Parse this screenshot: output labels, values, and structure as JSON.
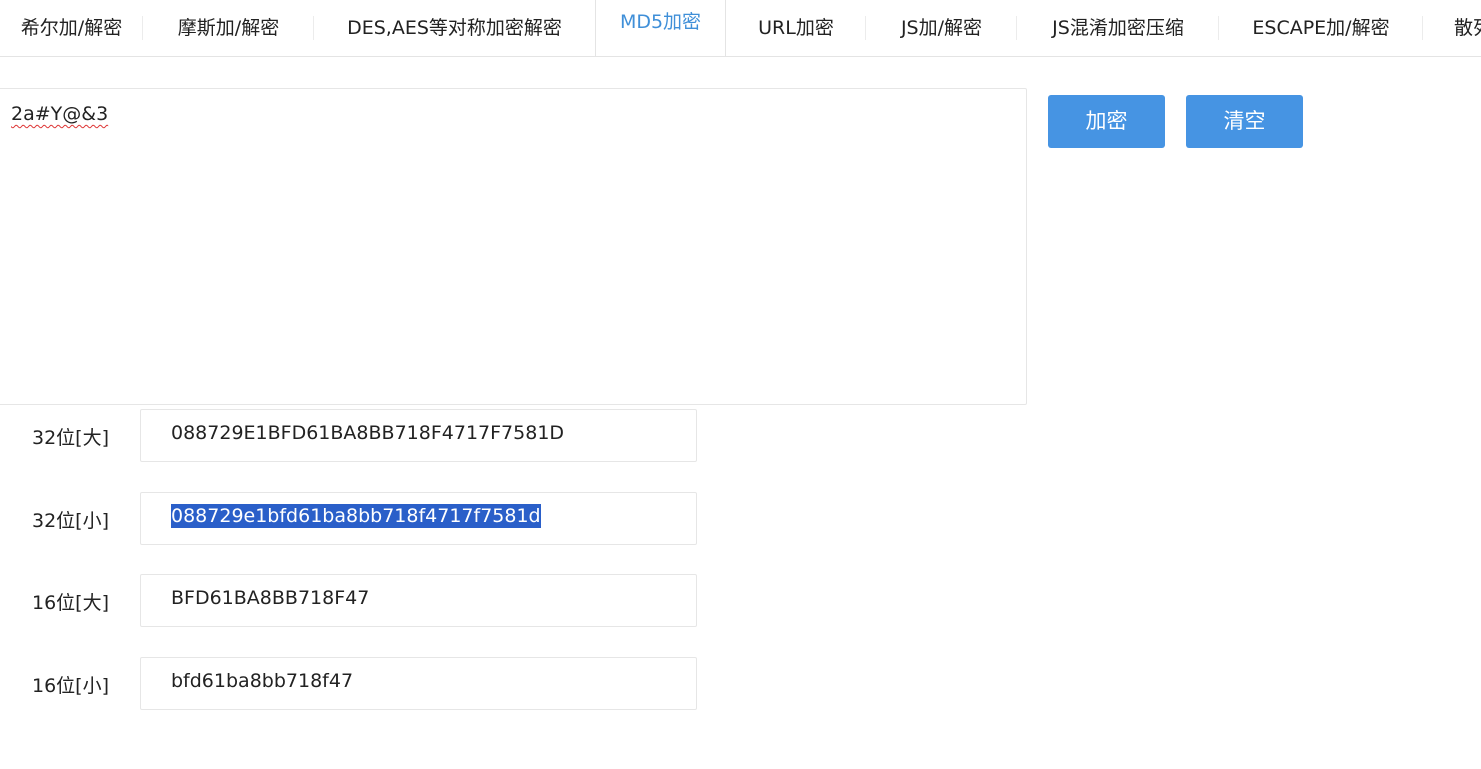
{
  "tabs": [
    {
      "label": "希尔加/解密"
    },
    {
      "label": "摩斯加/解密"
    },
    {
      "label": "DES,AES等对称加密解密"
    },
    {
      "label": "MD5加密"
    },
    {
      "label": "URL加密"
    },
    {
      "label": "JS加/解密"
    },
    {
      "label": "JS混淆加密压缩"
    },
    {
      "label": "ESCAPE加/解密"
    },
    {
      "label": "散列"
    }
  ],
  "active_tab": "MD5加密",
  "input": {
    "value": "2a#Y@&3"
  },
  "buttons": {
    "encrypt_label": "加密",
    "clear_label": "清空",
    "color": "#4694e3"
  },
  "results": [
    {
      "label": "32位[大]",
      "value": "088729E1BFD61BA8BB718F4717F7581D"
    },
    {
      "label": "32位[小]",
      "value": "088729e1bfd61ba8bb718f4717f7581d",
      "selected": true
    },
    {
      "label": "16位[大]",
      "value": "BFD61BA8BB718F47"
    },
    {
      "label": "16位[小]",
      "value": "bfd61ba8bb718f47"
    }
  ],
  "colors": {
    "active_tab": "#3f8fd8",
    "selection": "#2a5fc9"
  }
}
